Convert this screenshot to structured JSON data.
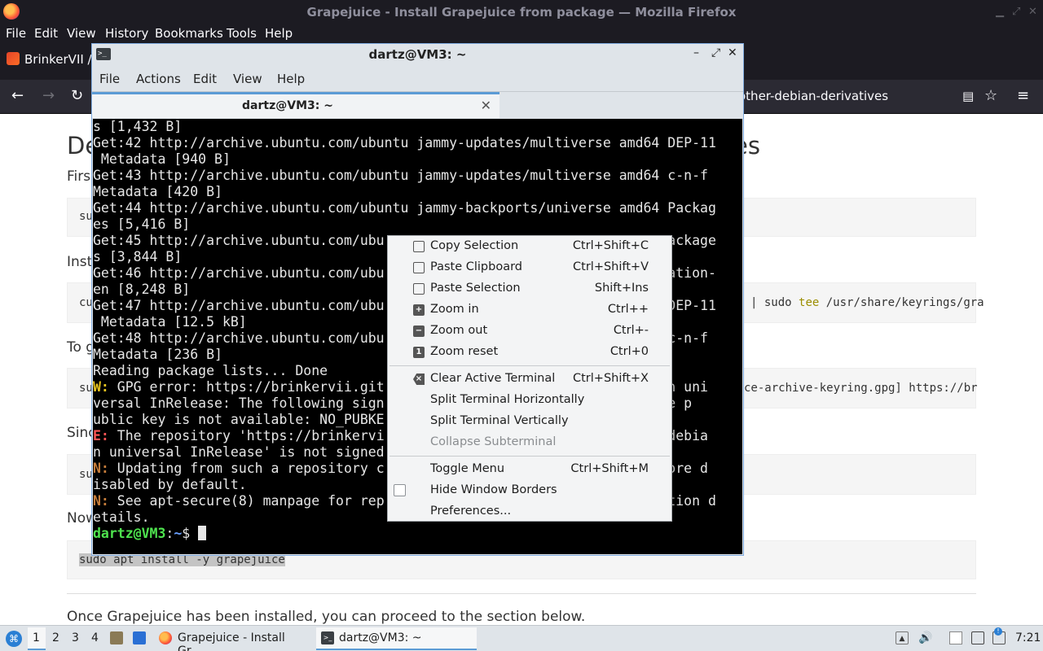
{
  "firefox": {
    "window_title": "Grapejuice - Install Grapejuice from package — Mozilla Firefox",
    "menu": [
      "File",
      "Edit",
      "View",
      "History",
      "Bookmarks",
      "Tools",
      "Help"
    ],
    "tab_label": "BrinkerVII /",
    "url_tail": "other-debian-derivatives"
  },
  "page": {
    "heading_start": "De",
    "heading_end": "es",
    "para1": "Firs",
    "code1": "su",
    "para2": "Inst",
    "code2_left": "cu",
    "code2_right_a": "| sudo ",
    "code2_right_tee": "tee",
    "code2_right_b": " /usr/share/keyrings/gra",
    "para3": "To g",
    "code3_left": "su",
    "code3_right": "ce-archive-keyring.gpg] https://br",
    "para4": "Sinc",
    "code4": "su",
    "para5": "Now",
    "code5": "sudo apt install -y grapejuice",
    "para6": "Once Grapejuice has been installed, you can proceed to the section below."
  },
  "terminal": {
    "title": "dartz@VM3: ~",
    "menu": [
      "File",
      "Actions",
      "Edit",
      "View",
      "Help"
    ],
    "tab_label": "dartz@VM3: ~",
    "lines": [
      "s [1,432 B]",
      "Get:42 http://archive.ubuntu.com/ubuntu jammy-updates/multiverse amd64 DEP-11",
      " Metadata [940 B]",
      "Get:43 http://archive.ubuntu.com/ubuntu jammy-updates/multiverse amd64 c-n-f",
      "Metadata [420 B]",
      "Get:44 http://archive.ubuntu.com/ubuntu jammy-backports/universe amd64 Packag",
      "es [5,416 B]",
      "Get:45 http://archive.ubuntu.com/ubu                                   ackage",
      "s [3,844 B]",
      "Get:46 http://archive.ubuntu.com/ubu                                   ation-",
      "en [8,248 B]",
      "Get:47 http://archive.ubuntu.com/ubu                                   DEP-11",
      " Metadata [12.5 kB]",
      "Get:48 http://archive.ubuntu.com/ubu                                   c-n-f",
      "Metadata [236 B]",
      "Reading package lists... Done"
    ],
    "w_tag": "W:",
    "w_line": " GPG error: https://brinkervii.git                                  an uni",
    "w_cont1": "versal InRelease: The following sign                                 the p",
    "w_cont2": "ublic key is not available: NO_PUBKE",
    "e_tag": "E:",
    "e_line": " The repository 'https://brinkervi                                  /debia",
    "e_cont": "n universal InRelease' is not signed",
    "n1_tag": "N:",
    "n1_line": " Updating from such a repository c                                  fore d",
    "n1_cont": "isabled by default.",
    "n2_tag": "N:",
    "n2_line": " See apt-secure(8) manpage for rep                                  ation d",
    "n2_cont": "etails.",
    "prompt_user": "dartz@VM3",
    "prompt_sep": ":",
    "prompt_path": "~",
    "prompt_sym": "$ "
  },
  "context_menu": {
    "items": [
      {
        "label": "Copy Selection",
        "accel": "Ctrl+Shift+C",
        "icon": "copy-icon"
      },
      {
        "label": "Paste Clipboard",
        "accel": "Ctrl+Shift+V",
        "icon": "paste-icon"
      },
      {
        "label": "Paste Selection",
        "accel": "Shift+Ins",
        "icon": "paste-icon"
      },
      {
        "label": "Zoom in",
        "accel": "Ctrl++",
        "icon": "zoom-in-icon"
      },
      {
        "label": "Zoom out",
        "accel": "Ctrl+-",
        "icon": "zoom-out-icon"
      },
      {
        "label": "Zoom reset",
        "accel": "Ctrl+0",
        "icon": "zoom-reset-icon"
      },
      {
        "label": "Clear Active Terminal",
        "accel": "Ctrl+Shift+X",
        "icon": "clear-icon"
      },
      {
        "label": "Split Terminal Horizontally",
        "accel": ""
      },
      {
        "label": "Split Terminal Vertically",
        "accel": ""
      },
      {
        "label": "Collapse Subterminal",
        "accel": "",
        "disabled": true
      },
      {
        "label": "Toggle Menu",
        "accel": "Ctrl+Shift+M"
      },
      {
        "label": "Hide Window Borders",
        "accel": "",
        "checkbox": false
      },
      {
        "label": "Preferences...",
        "accel": ""
      }
    ]
  },
  "taskbar": {
    "desktops": [
      "1",
      "2",
      "3",
      "4"
    ],
    "tasks": [
      "Grapejuice - Install Gr...",
      "dartz@VM3: ~"
    ],
    "clock": "7:21"
  },
  "colors": {
    "accent": "#5b9bd5",
    "terminal_bg": "#000000",
    "prompt_green": "#4ee34e"
  }
}
